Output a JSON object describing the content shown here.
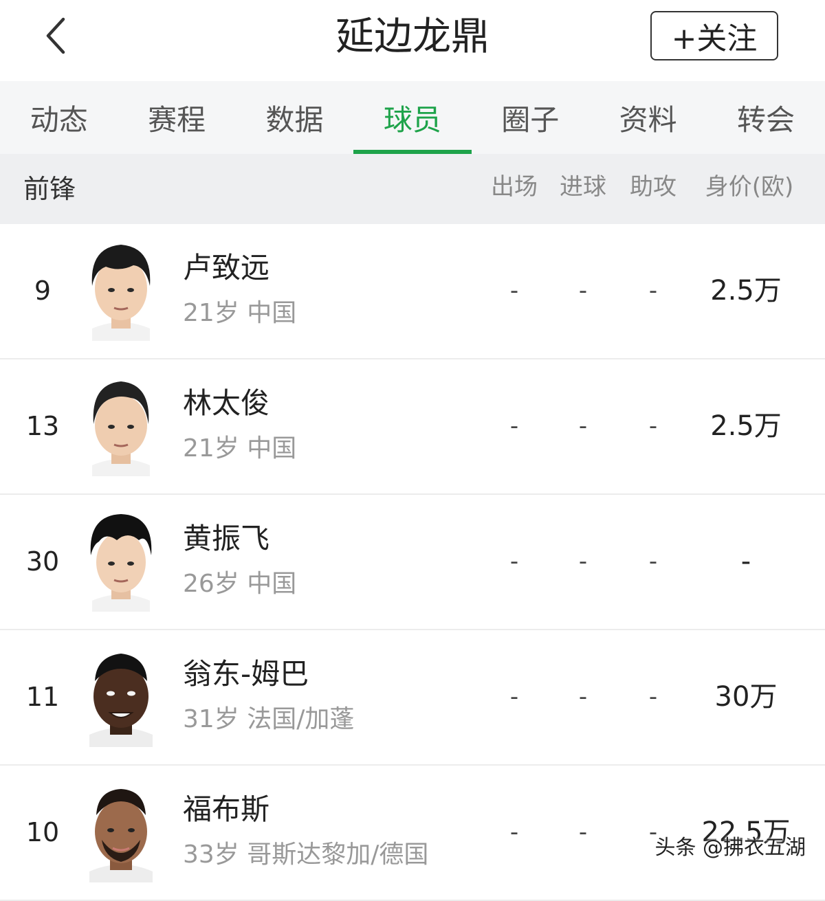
{
  "header": {
    "title": "延边龙鼎",
    "follow_label": "+关注"
  },
  "tabs": [
    {
      "label": "动态",
      "active": false
    },
    {
      "label": "赛程",
      "active": false
    },
    {
      "label": "数据",
      "active": false
    },
    {
      "label": "球员",
      "active": true
    },
    {
      "label": "圈子",
      "active": false
    },
    {
      "label": "资料",
      "active": false
    },
    {
      "label": "转会",
      "active": false
    }
  ],
  "section": {
    "title": "前锋",
    "columns": [
      "出场",
      "进球",
      "助攻",
      "身价(欧)"
    ]
  },
  "players": [
    {
      "number": "9",
      "name": "卢致远",
      "info": "21岁 中国",
      "apps": "-",
      "goals": "-",
      "assists": "-",
      "value": "2.5万"
    },
    {
      "number": "13",
      "name": "林太俊",
      "info": "21岁 中国",
      "apps": "-",
      "goals": "-",
      "assists": "-",
      "value": "2.5万"
    },
    {
      "number": "30",
      "name": "黄振飞",
      "info": "26岁 中国",
      "apps": "-",
      "goals": "-",
      "assists": "-",
      "value": "-"
    },
    {
      "number": "11",
      "name": "翁东-姆巴",
      "info": "31岁 法国/加蓬",
      "apps": "-",
      "goals": "-",
      "assists": "-",
      "value": "30万"
    },
    {
      "number": "10",
      "name": "福布斯",
      "info": "33岁 哥斯达黎加/德国",
      "apps": "-",
      "goals": "-",
      "assists": "-",
      "value": "22.5万"
    }
  ],
  "watermark": "头条 @拂衣五湖",
  "colors": {
    "accent": "#1ea34a",
    "header_bg": "#f5f6f7",
    "section_bg": "#eeeff1"
  }
}
